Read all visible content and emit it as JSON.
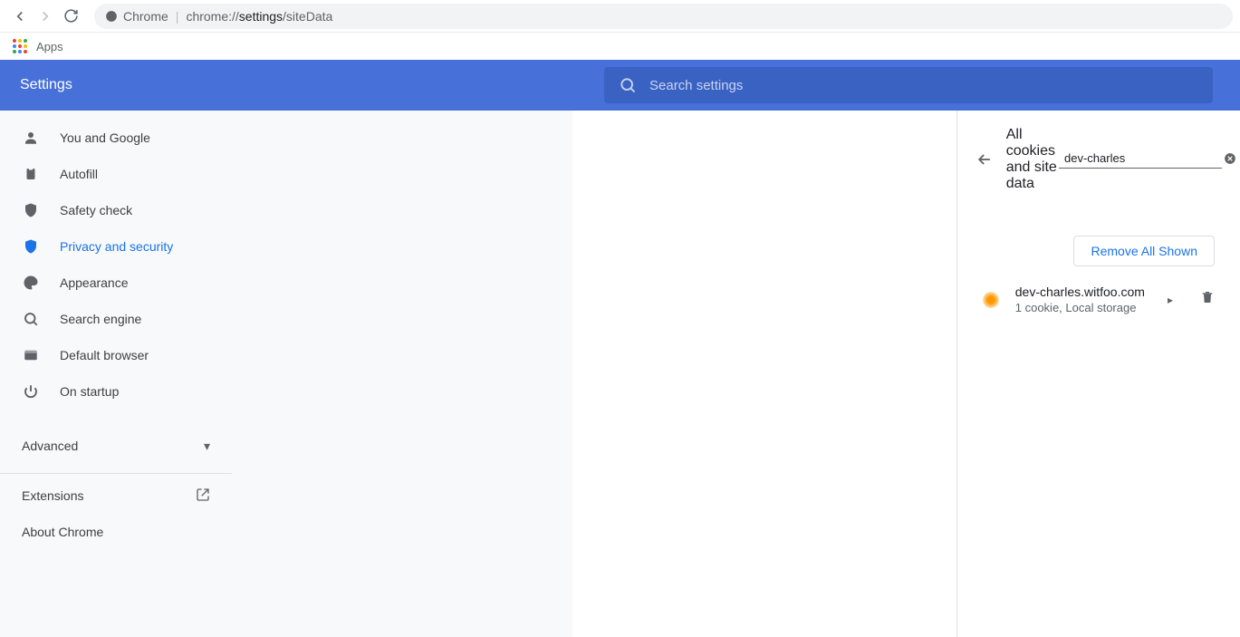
{
  "browser": {
    "chip_label": "Chrome",
    "url_prefix": "chrome://",
    "url_strong": "settings",
    "url_suffix": "/siteData"
  },
  "bookmarks": {
    "apps_label": "Apps"
  },
  "header": {
    "title": "Settings",
    "search_placeholder": "Search settings"
  },
  "sidebar": {
    "items": [
      {
        "label": "You and Google"
      },
      {
        "label": "Autofill"
      },
      {
        "label": "Safety check"
      },
      {
        "label": "Privacy and security"
      },
      {
        "label": "Appearance"
      },
      {
        "label": "Search engine"
      },
      {
        "label": "Default browser"
      },
      {
        "label": "On startup"
      }
    ],
    "advanced_label": "Advanced",
    "extensions_label": "Extensions",
    "about_label": "About Chrome"
  },
  "content": {
    "page_title": "All cookies and site data",
    "search_value": "dev-charles",
    "remove_all_label": "Remove All Shown",
    "site": {
      "name": "dev-charles.witfoo.com",
      "desc": "1 cookie, Local storage"
    }
  }
}
